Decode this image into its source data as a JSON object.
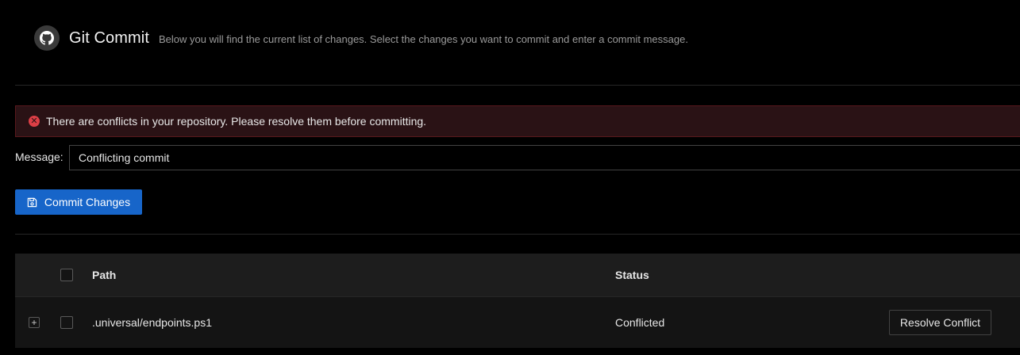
{
  "header": {
    "logo_icon": "github-icon",
    "title": "Git Commit",
    "subtitle": "Below you will find the current list of changes. Select the changes you want to commit and enter a commit message."
  },
  "alert": {
    "icon": "close-circle-icon",
    "text": "There are conflicts in your repository. Please resolve them before committing.",
    "color": "#dc3f46"
  },
  "message": {
    "label": "Message:",
    "value": "Conflicting commit"
  },
  "commit_button": {
    "icon": "save-icon",
    "label": "Commit Changes",
    "color": "#1765c9"
  },
  "table": {
    "columns": [
      "Path",
      "Status"
    ],
    "rows": [
      {
        "path": ".universal/endpoints.ps1",
        "status": "Conflicted",
        "action": "Resolve Conflict"
      }
    ]
  }
}
